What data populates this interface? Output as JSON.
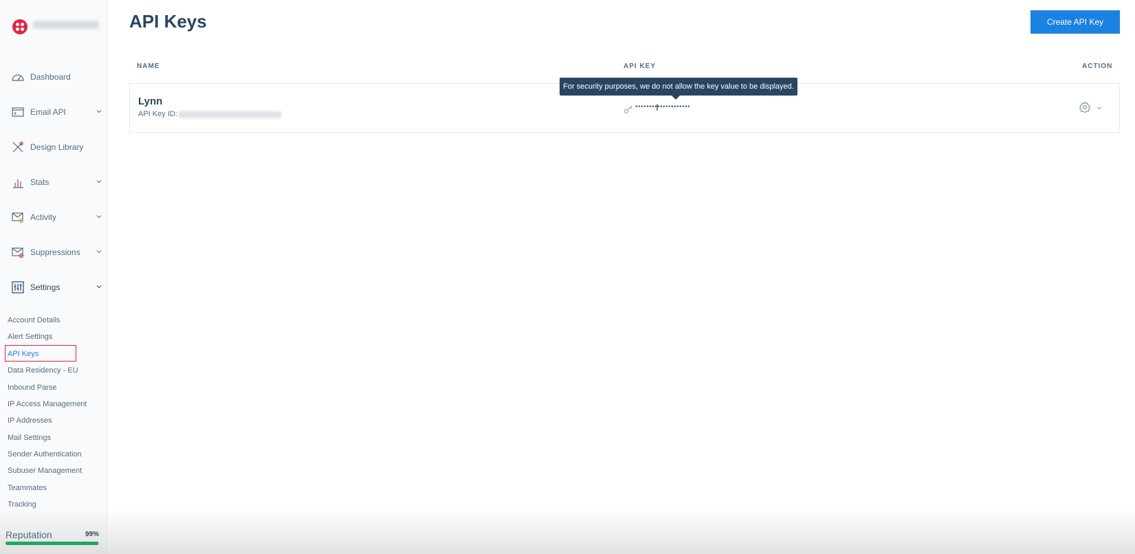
{
  "sidebar": {
    "nav": [
      {
        "label": "Dashboard",
        "icon": "speedometer-icon",
        "has_chevron": false
      },
      {
        "label": "Email API",
        "icon": "terminal-icon",
        "has_chevron": true
      },
      {
        "label": "Design Library",
        "icon": "tools-icon",
        "has_chevron": false
      },
      {
        "label": "Stats",
        "icon": "bar-chart-icon",
        "has_chevron": true
      },
      {
        "label": "Activity",
        "icon": "mail-search-icon",
        "has_chevron": true
      },
      {
        "label": "Suppressions",
        "icon": "mail-blocked-icon",
        "has_chevron": true
      },
      {
        "label": "Settings",
        "icon": "sliders-icon",
        "has_chevron": true
      }
    ],
    "settings_items": [
      "Account Details",
      "Alert Settings",
      "API Keys",
      "Data Residency - EU",
      "Inbound Parse",
      "IP Access Management",
      "IP Addresses",
      "Mail Settings",
      "Sender Authentication",
      "Subuser Management",
      "Teammates",
      "Tracking"
    ],
    "active_item": "API Keys",
    "reputation": {
      "label": "Reputation",
      "value_text": "99%",
      "value": 99
    }
  },
  "main": {
    "title": "API Keys",
    "create_button": "Create API Key",
    "columns": {
      "name": "NAME",
      "api_key": "API KEY",
      "action": "ACTION"
    },
    "rows": [
      {
        "name": "Lynn",
        "id_label": "API Key ID:",
        "masked_key": "••••••••••••••••••••"
      }
    ],
    "tooltip": "For security purposes, we do not allow the key value to be displayed."
  },
  "colors": {
    "brand_red": "#e8203f",
    "primary_blue": "#1a82e2",
    "text_dark": "#294661",
    "text_muted": "#546b81",
    "reputation_green": "#22a566"
  }
}
